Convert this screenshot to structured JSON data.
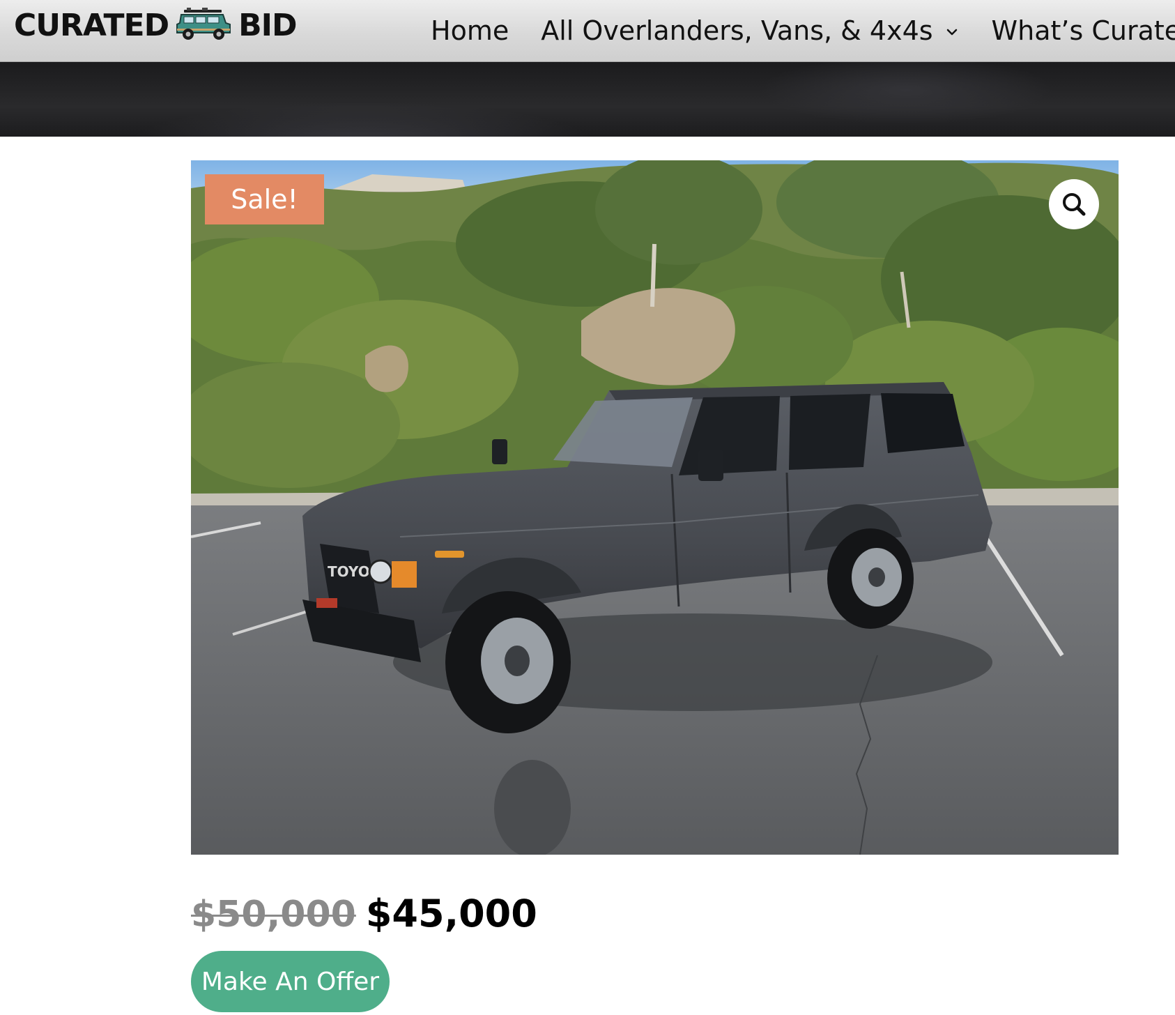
{
  "header": {
    "logo": {
      "word_left": "CURATED",
      "word_right": "BID",
      "emblem": "vintage-suv-icon"
    },
    "nav": [
      {
        "label": "Home",
        "has_dropdown": false
      },
      {
        "label": "All Overlanders, Vans, & 4x4s",
        "has_dropdown": true
      },
      {
        "label": "What’s Curated",
        "has_dropdown": false
      }
    ]
  },
  "product": {
    "badge": "Sale!",
    "zoom_icon": "magnifier-icon",
    "image_subject": "gray-toyota-suv-photo",
    "grille_text": "TOYOTA",
    "old_price": "$50,000",
    "price": "$45,000",
    "offer_label": "Make An Offer"
  },
  "colors": {
    "badge": "#e38a64",
    "offer_button": "#4fae8a",
    "old_price": "#8a8a8a"
  }
}
